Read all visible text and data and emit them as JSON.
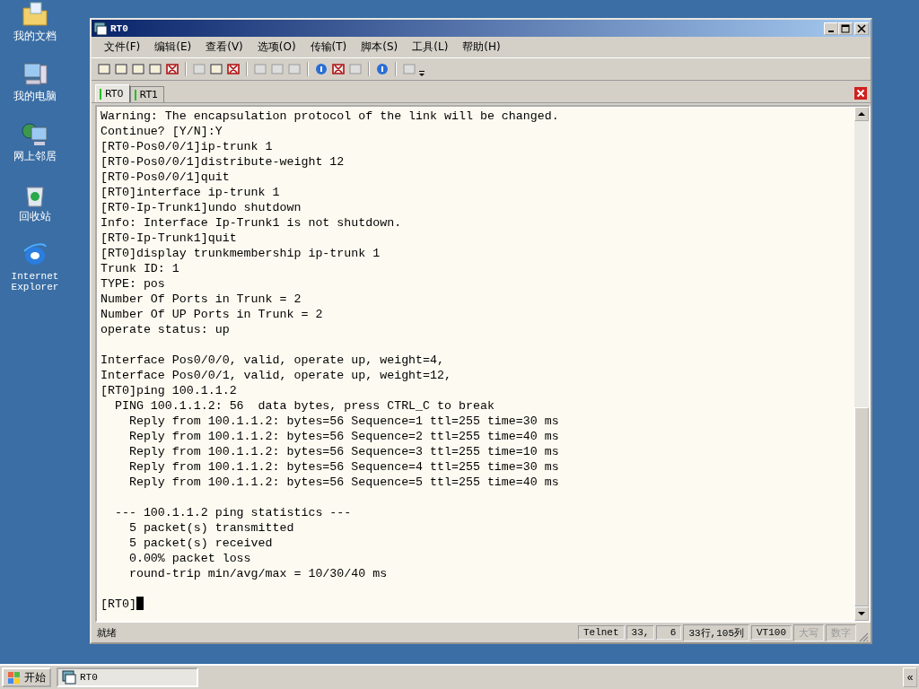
{
  "desktop_icons": [
    {
      "kind": "documents",
      "label": "我的文档"
    },
    {
      "kind": "computer",
      "label": "我的电脑"
    },
    {
      "kind": "network",
      "label": "网上邻居"
    },
    {
      "kind": "recycle",
      "label": "回收站"
    },
    {
      "kind": "browser",
      "label": "Internet Explorer"
    }
  ],
  "window": {
    "title": "RT0"
  },
  "menu": [
    "文件(F)",
    "编辑(E)",
    "查看(V)",
    "选项(O)",
    "传输(T)",
    "脚本(S)",
    "工具(L)",
    "帮助(H)"
  ],
  "tabs": [
    {
      "label": "RT0",
      "selected": true
    },
    {
      "label": "RT1",
      "selected": false
    }
  ],
  "terminal": {
    "lines": [
      {
        "text": "Warning: The encapsulation protocol of the link will be changed."
      },
      {
        "text": "Continue? [Y/N]:Y"
      },
      {
        "text": "[RT0-Pos0/0/1]ip-trunk 1"
      },
      {
        "text": "[RT0-Pos0/0/1]distribute-weight 12"
      },
      {
        "text": "[RT0-Pos0/0/1]quit"
      },
      {
        "text": "[RT0]interface ip-trunk 1"
      },
      {
        "text": "[RT0-Ip-Trunk1]undo shutdown"
      },
      {
        "text": "Info: Interface Ip-Trunk1 is not shutdown."
      },
      {
        "text": "[RT0-Ip-Trunk1]quit"
      },
      {
        "text": "[RT0]display trunkmembership ip-trunk 1"
      },
      {
        "text": "Trunk ID: 1"
      },
      {
        "text": "TYPE: pos"
      },
      {
        "text": "Number Of Ports in Trunk = 2"
      },
      {
        "text": "Number Of UP Ports in Trunk = 2"
      },
      {
        "text": "operate status: up"
      },
      {
        "text": "Interface Pos0/0/0, valid, operate up, weight=4,",
        "blank_before": true
      },
      {
        "text": "Interface Pos0/0/1, valid, operate up, weight=12,"
      },
      {
        "text": "[RT0]ping 100.1.1.2"
      },
      {
        "text": "  PING 100.1.1.2: 56  data bytes, press CTRL_C to break"
      },
      {
        "text": "    Reply from 100.1.1.2: bytes=56 Sequence=1 ttl=255 time=30 ms"
      },
      {
        "text": "    Reply from 100.1.1.2: bytes=56 Sequence=2 ttl=255 time=40 ms"
      },
      {
        "text": "    Reply from 100.1.1.2: bytes=56 Sequence=3 ttl=255 time=10 ms"
      },
      {
        "text": "    Reply from 100.1.1.2: bytes=56 Sequence=4 ttl=255 time=30 ms"
      },
      {
        "text": "    Reply from 100.1.1.2: bytes=56 Sequence=5 ttl=255 time=40 ms"
      },
      {
        "text": "  --- 100.1.1.2 ping statistics ---",
        "blank_before": true
      },
      {
        "text": "    5 packet(s) transmitted"
      },
      {
        "text": "    5 packet(s) received"
      },
      {
        "text": "    0.00% packet loss"
      },
      {
        "text": "    round-trip min/avg/max = 10/30/40 ms"
      },
      {
        "text": "[RT0]",
        "blank_before": true,
        "cursor": true
      }
    ]
  },
  "status_bar": {
    "message": "就绪",
    "protocol": "Telnet",
    "row": "33,",
    "column": "6",
    "size": "33行,105列",
    "emulation": "VT100",
    "indicators": [
      {
        "label": "大写",
        "on": false
      },
      {
        "label": "数字",
        "on": false
      }
    ]
  },
  "taskbar": {
    "start": "开始",
    "tasks": [
      {
        "label": "RT0",
        "selected": false
      }
    ],
    "expand": "«"
  }
}
